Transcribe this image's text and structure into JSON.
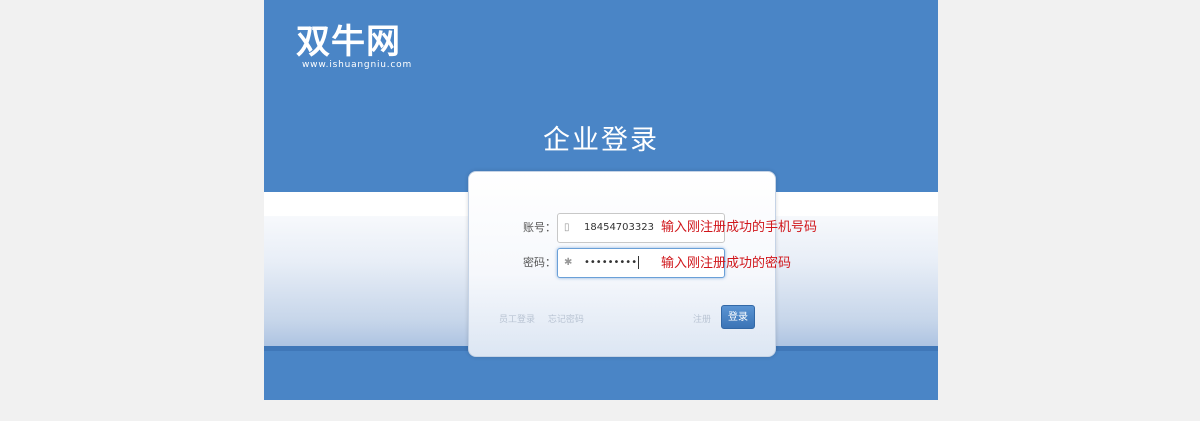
{
  "brand": {
    "logo_text": "双牛网",
    "url": "www.ishuangniu.com"
  },
  "page": {
    "title": "企业登录"
  },
  "form": {
    "account_label": "账号：",
    "account_icon": "phone-icon",
    "account_value": "18454703323",
    "password_label": "密码：",
    "password_icon": "asterisk-icon",
    "password_value": "•••••••••",
    "employee_login": "员工登录",
    "forgot_password": "忘记密码",
    "register": "注册",
    "login_button": "登录"
  },
  "annotations": {
    "account_hint": "输入刚注册成功的手机号码",
    "password_hint": "输入刚注册成功的密码"
  },
  "colors": {
    "background": "#4a85c6",
    "accent": "#3b74b6",
    "note": "#d0161b"
  }
}
